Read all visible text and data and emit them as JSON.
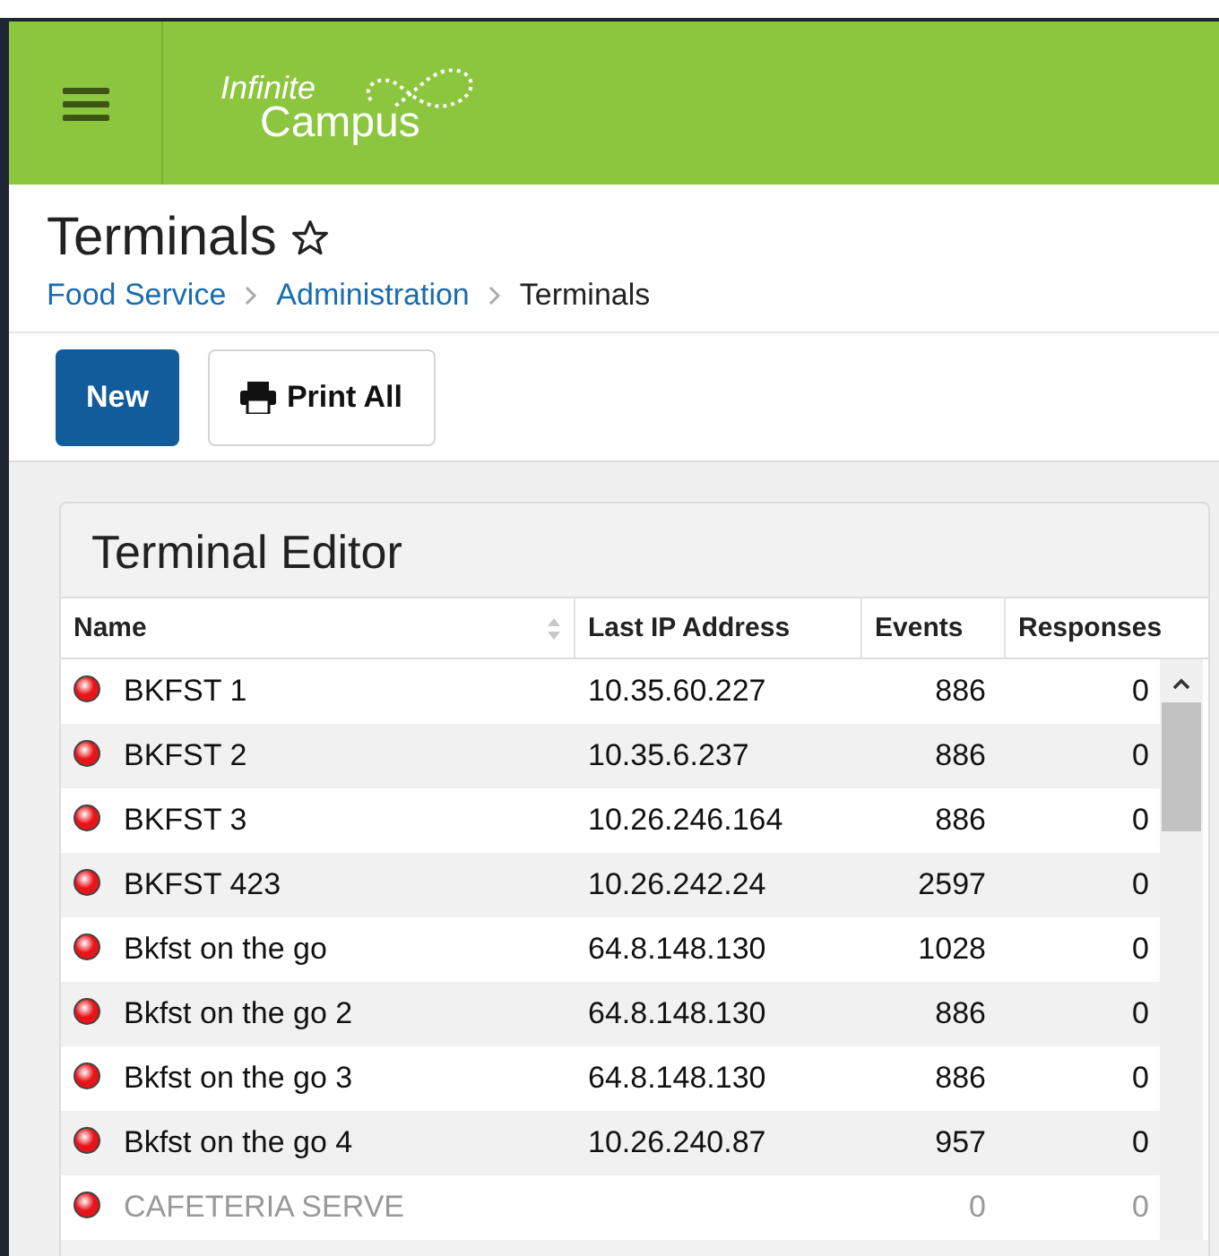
{
  "header": {
    "logo_line_1": "Infinite",
    "logo_line_2": "Campus"
  },
  "page": {
    "title": "Terminals",
    "favorite": false,
    "breadcrumbs": [
      {
        "label": "Food Service",
        "link": true
      },
      {
        "label": "Administration",
        "link": true
      },
      {
        "label": "Terminals",
        "link": false
      }
    ]
  },
  "toolbar": {
    "buttons": [
      {
        "label": "New",
        "kind": "primary"
      },
      {
        "label": "Print All",
        "kind": "print"
      }
    ]
  },
  "panel": {
    "title": "Terminal Editor",
    "table": {
      "columns": [
        {
          "label": "Name",
          "sortable": true
        },
        {
          "label": "Last IP Address",
          "sortable": false
        },
        {
          "label": "Events",
          "sortable": false
        },
        {
          "label": "Responses",
          "sortable": false
        }
      ],
      "rows": [
        {
          "name": "BKFST 1",
          "ip": "10.35.60.227",
          "events": "886",
          "responses": "0",
          "disabled": false,
          "color": "#e8141a"
        },
        {
          "name": "BKFST 2",
          "ip": "10.35.6.237",
          "events": "886",
          "responses": "0",
          "disabled": false,
          "color": "#e8141a"
        },
        {
          "name": "BKFST 3",
          "ip": "10.26.246.164",
          "events": "886",
          "responses": "0",
          "disabled": false,
          "color": "#e8141a"
        },
        {
          "name": "BKFST 423",
          "ip": "10.26.242.24",
          "events": "2597",
          "responses": "0",
          "disabled": false,
          "color": "#e8141a"
        },
        {
          "name": "Bkfst on the go",
          "ip": "64.8.148.130",
          "events": "1028",
          "responses": "0",
          "disabled": false,
          "color": "#e8141a"
        },
        {
          "name": "Bkfst on the go 2",
          "ip": "64.8.148.130",
          "events": "886",
          "responses": "0",
          "disabled": false,
          "color": "#e8141a"
        },
        {
          "name": "Bkfst on the go 3",
          "ip": "64.8.148.130",
          "events": "886",
          "responses": "0",
          "disabled": false,
          "color": "#e8141a"
        },
        {
          "name": "Bkfst on the go 4",
          "ip": "10.26.240.87",
          "events": "957",
          "responses": "0",
          "disabled": false,
          "color": "#e8141a"
        },
        {
          "name": "CAFETERIA SERVE",
          "events": "0",
          "responses": "0",
          "disabled": true,
          "color": "#e8141a"
        }
      ]
    }
  }
}
